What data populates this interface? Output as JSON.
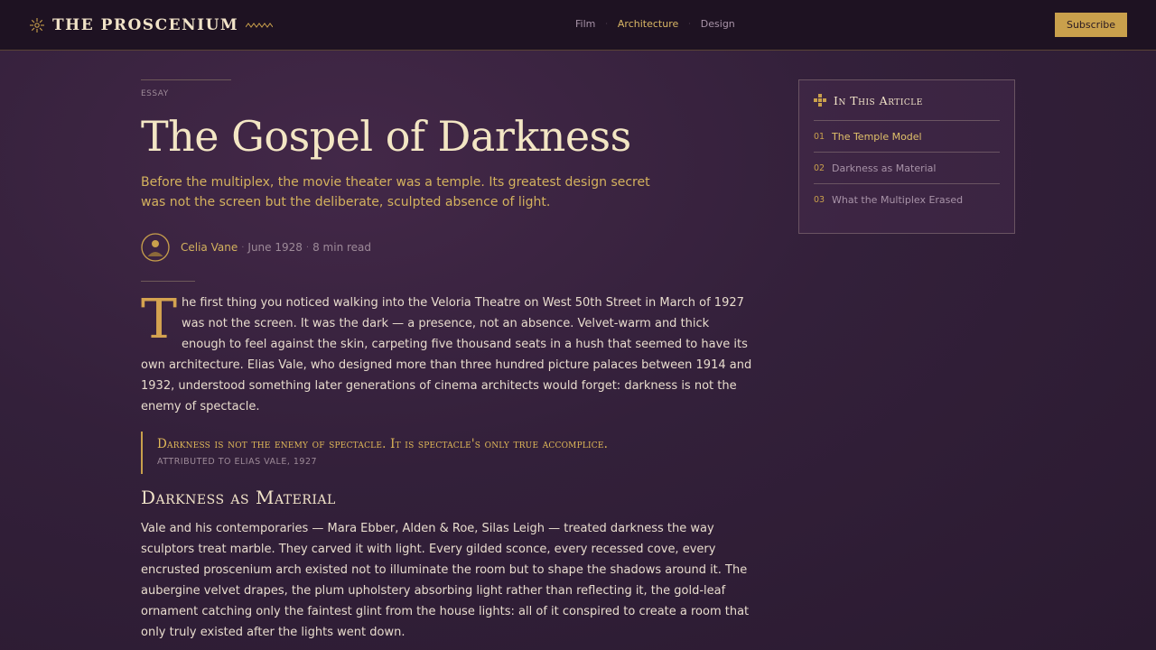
{
  "header": {
    "brand": "THE PROSCENIUM",
    "nav": [
      {
        "label": "Film",
        "active": false
      },
      {
        "label": "Architecture",
        "active": true
      },
      {
        "label": "Design",
        "active": false
      }
    ],
    "nav_separator": "·",
    "subscribe_label": "Subscribe"
  },
  "article": {
    "kicker": "ESSAY",
    "title": "The Gospel of Darkness",
    "dek": "Before the multiplex, the movie theater was a temple. Its greatest design secret was not the screen but the deliberate, sculpted absence of light.",
    "byline": {
      "author": "Celia Vane",
      "date": "June 1928",
      "read_time": "8 min read",
      "separator": "·"
    },
    "lead_dropcap": "T",
    "lead_text": "he first thing you noticed walking into the Veloria Theatre on West 50th Street in March of 1927 was not the screen. It was the dark — a presence, not an absence. Velvet-warm and thick enough to feel against the skin, carpeting five thousand seats in a hush that seemed to have its own architecture. Elias Vale, who designed more than three hundred picture palaces between 1914 and 1932, understood something later generations of cinema architects would forget: darkness is not the enemy of spectacle.",
    "pullquote": {
      "quote": "Darkness is not the enemy of spectacle. It is spectacle's only true accomplice.",
      "attribution": "ATTRIBUTED TO ELIAS VALE, 1927"
    },
    "section_title": "Darkness as Material",
    "section_text": "Vale and his contemporaries — Mara Ebber, Alden & Roe, Silas Leigh — treated darkness the way sculptors treat marble. They carved it with light. Every gilded sconce, every recessed cove, every encrusted proscenium arch existed not to illuminate the room but to shape the shadows around it. The aubergine velvet drapes, the plum upholstery absorbing light rather than reflecting it, the gold-leaf ornament catching only the faintest glint from the house lights: all of it conspired to create a room that only truly existed after the lights went down."
  },
  "toc": {
    "heading": "In This Article",
    "items": [
      {
        "num": "01",
        "label": "The Temple Model",
        "current": true
      },
      {
        "num": "02",
        "label": "Darkness as Material",
        "current": false
      },
      {
        "num": "03",
        "label": "What the Multiplex Erased",
        "current": false
      }
    ]
  },
  "colors": {
    "accent_gold": "#c9a04c",
    "background": "#33203a",
    "header_bg": "#1e1222"
  },
  "icons": {
    "brand": "sunburst-icon",
    "brand_ornament": "zigzag-icon",
    "author": "avatar-icon",
    "toc": "plus-ornament-icon"
  }
}
